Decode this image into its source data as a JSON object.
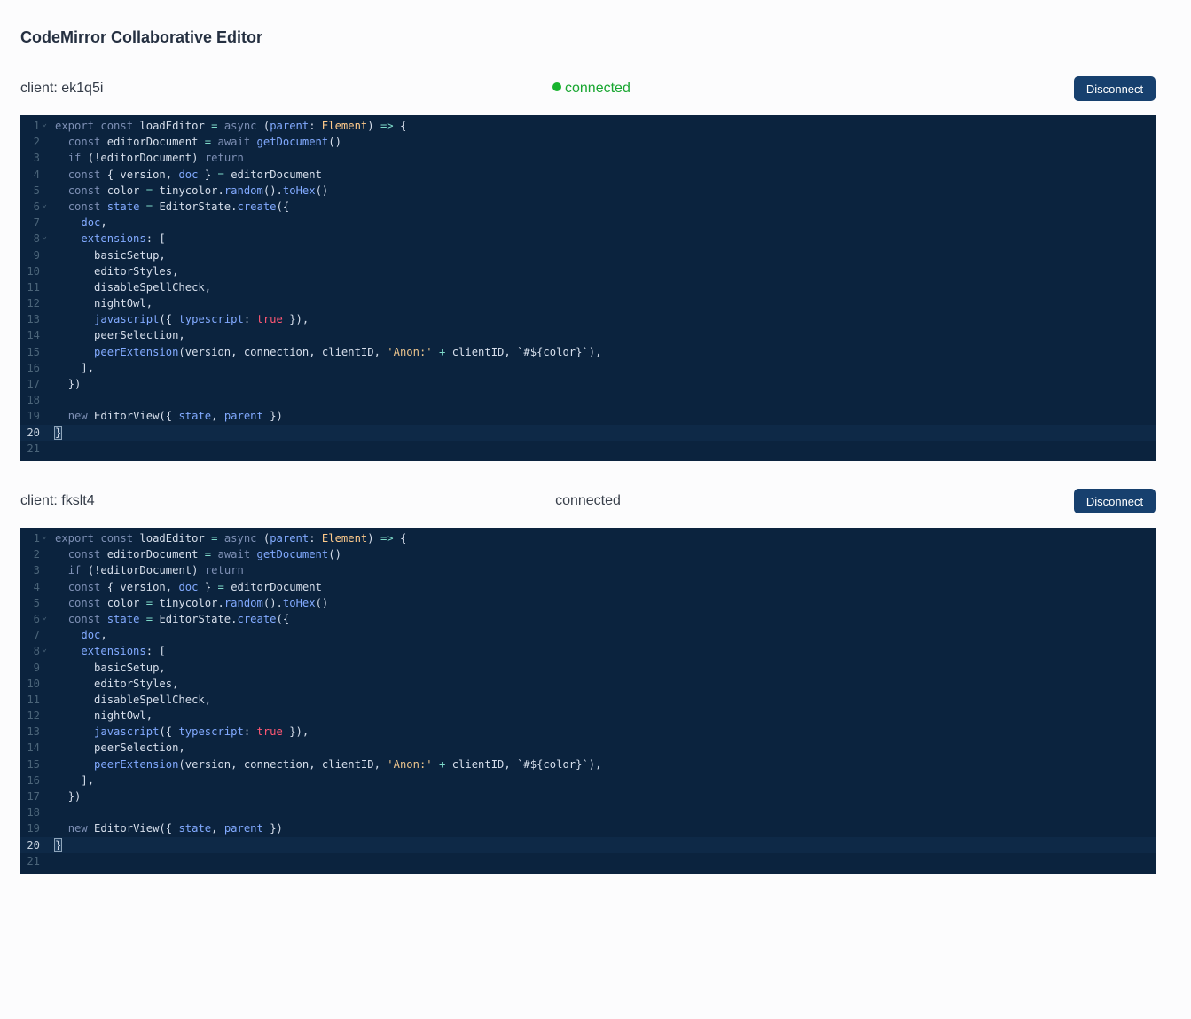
{
  "title": "CodeMirror Collaborative Editor",
  "colors": {
    "editor_bg": "#0b233e",
    "button_bg": "#17406e",
    "connected": "#18a630"
  },
  "clients": [
    {
      "id_label": "client: ek1q5i",
      "status": "connected",
      "status_indicator": true,
      "button_label": "Disconnect",
      "active_line": 20
    },
    {
      "id_label": "client: fkslt4",
      "status": "connected",
      "status_indicator": false,
      "button_label": "Disconnect",
      "active_line": 20
    }
  ],
  "code_lines": [
    "export const loadEditor = async (parent: Element) => {",
    "  const editorDocument = await getDocument()",
    "  if (!editorDocument) return",
    "  const { version, doc } = editorDocument",
    "  const color = tinycolor.random().toHex()",
    "  const state = EditorState.create({",
    "    doc,",
    "    extensions: [",
    "      basicSetup,",
    "      editorStyles,",
    "      disableSpellCheck,",
    "      nightOwl,",
    "      javascript({ typescript: true }),",
    "      peerSelection,",
    "      peerExtension(version, connection, clientID, 'Anon:' + clientID, `#${color}`),",
    "    ],",
    "  })",
    "",
    "  new EditorView({ state, parent })",
    "}",
    ""
  ],
  "fold_lines": [
    1,
    6,
    8
  ],
  "icons": {
    "fold_marker": "chevron-down-icon",
    "status_dot": "status-dot-icon"
  }
}
